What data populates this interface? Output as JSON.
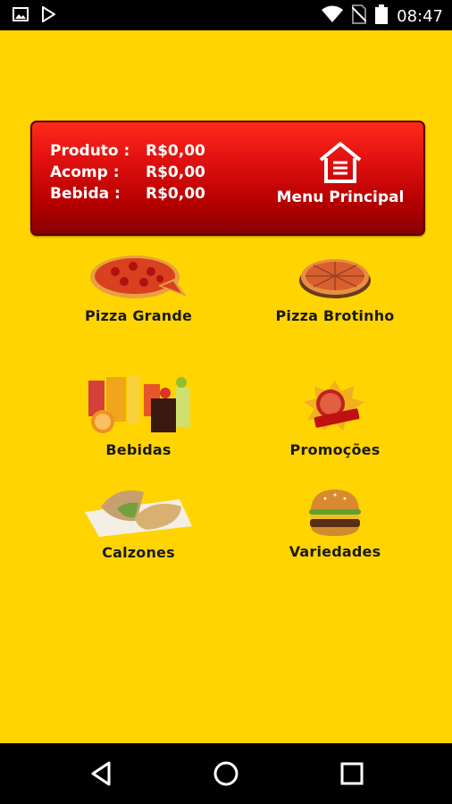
{
  "status_bar": {
    "time": "08:47",
    "icons": [
      "image-icon",
      "play-store-icon",
      "wifi-icon",
      "no-sim-icon",
      "battery-icon"
    ]
  },
  "header": {
    "totals": [
      {
        "label": "Produto :",
        "value": "R$0,00"
      },
      {
        "label": "Acomp :",
        "value": "R$0,00"
      },
      {
        "label": "Bebida :",
        "value": "R$0,00"
      }
    ],
    "menu_button_label": "Menu Principal"
  },
  "menu": {
    "items": [
      {
        "label": "Pizza Grande",
        "icon": "pizza-icon"
      },
      {
        "label": "Pizza Brotinho",
        "icon": "pizza-icon"
      },
      {
        "label": "Bebidas",
        "icon": "drinks-icon"
      },
      {
        "label": "Promoções",
        "icon": "promo-tag-icon"
      },
      {
        "label": "Calzones",
        "icon": "calzone-icon"
      },
      {
        "label": "Variedades",
        "icon": "burger-icon"
      }
    ]
  },
  "nav_bar": {
    "buttons": [
      "back-icon",
      "home-icon",
      "recents-icon"
    ]
  },
  "colors": {
    "background": "#FFD400",
    "card_red": "#C00000",
    "text_dark": "#1a1a1a"
  }
}
